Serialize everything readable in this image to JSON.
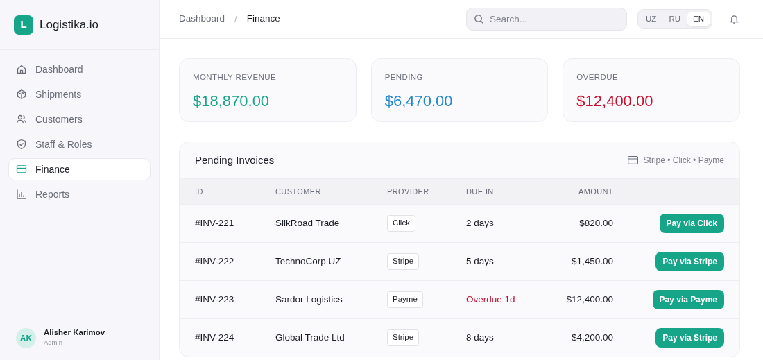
{
  "brand": {
    "logo_letter": "L",
    "name": "Logistika.io"
  },
  "sidebar": {
    "items": [
      {
        "label": "Dashboard",
        "kind": "home",
        "selected": false
      },
      {
        "label": "Shipments",
        "kind": "box",
        "selected": false
      },
      {
        "label": "Customers",
        "kind": "users",
        "selected": false
      },
      {
        "label": "Staff & Roles",
        "kind": "shield",
        "selected": false
      },
      {
        "label": "Finance",
        "kind": "card",
        "selected": true
      },
      {
        "label": "Reports",
        "kind": "chart",
        "selected": false
      }
    ]
  },
  "user": {
    "initials": "AK",
    "name": "Alisher Karimov",
    "role": "Admin"
  },
  "breadcrumb": {
    "separator": "/",
    "items": [
      {
        "label": "Dashboard",
        "current": false
      },
      {
        "label": "Finance",
        "current": true
      }
    ]
  },
  "search": {
    "placeholder": "Search..."
  },
  "languages": [
    {
      "label": "UZ",
      "selected": false
    },
    {
      "label": "RU",
      "selected": false
    },
    {
      "label": "EN",
      "selected": true
    }
  ],
  "stats": [
    {
      "label": "MONTHLY REVENUE",
      "value": "$18,870.00",
      "color": "#17a589"
    },
    {
      "label": "PENDING",
      "value": "$6,470.00",
      "color": "#1f86cf"
    },
    {
      "label": "OVERDUE",
      "value": "$12,400.00",
      "color": "#c8102e"
    }
  ],
  "invoices": {
    "title": "Pending Invoices",
    "providers_note": "Stripe • Click • Payme",
    "columns": [
      "ID",
      "CUSTOMER",
      "PROVIDER",
      "DUE IN",
      "AMOUNT"
    ],
    "rows": [
      {
        "id": "#INV-221",
        "customer": "SilkRoad Trade",
        "provider": "Click",
        "due": "2 days",
        "overdue": false,
        "amount": "$820.00",
        "action": "Pay via Click"
      },
      {
        "id": "#INV-222",
        "customer": "TechnoCorp UZ",
        "provider": "Stripe",
        "due": "5 days",
        "overdue": false,
        "amount": "$1,450.00",
        "action": "Pay via Stripe"
      },
      {
        "id": "#INV-223",
        "customer": "Sardor Logistics",
        "provider": "Payme",
        "due": "Overdue 1d",
        "overdue": true,
        "amount": "$12,400.00",
        "action": "Pay via Payme"
      },
      {
        "id": "#INV-224",
        "customer": "Global Trade Ltd",
        "provider": "Stripe",
        "due": "8 days",
        "overdue": false,
        "amount": "$4,200.00",
        "action": "Pay via Stripe"
      }
    ]
  }
}
